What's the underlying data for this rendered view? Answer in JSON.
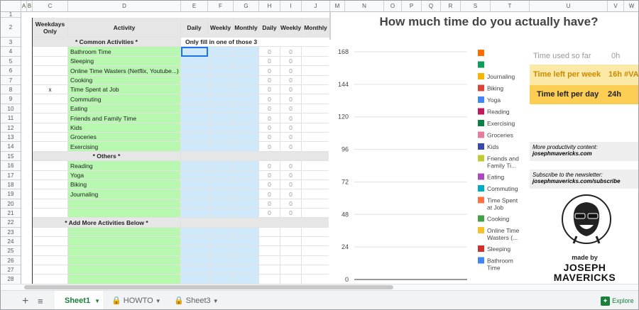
{
  "columns": [
    "A",
    "B",
    "C",
    "D",
    "E",
    "F",
    "G",
    "H",
    "I",
    "J",
    "M",
    "N",
    "O",
    "P",
    "Q",
    "R",
    "S",
    "T",
    "U",
    "V",
    "W"
  ],
  "rows": [
    "1",
    "2",
    "3",
    "4",
    "5",
    "6",
    "7",
    "8",
    "9",
    "10",
    "11",
    "12",
    "13",
    "14",
    "15",
    "16",
    "17",
    "18",
    "19",
    "20",
    "21",
    "22",
    "23",
    "24",
    "25",
    "26",
    "27",
    "28"
  ],
  "headers": {
    "weekdays_only": "Weekdays Only",
    "activity": "Activity",
    "daily": "Daily",
    "weekly": "Weekly",
    "monthly": "Monthly",
    "daily2": "Daily",
    "weekly2": "Weekly",
    "monthly2": "Monthly"
  },
  "sections": {
    "common": "* Common Activities *",
    "hint": "Only fill in one of those 3",
    "others": "* Others *",
    "add_more": "* Add More Activities Below *"
  },
  "activities_common": [
    "Bathroom Time",
    "Sleeping",
    "Online Time Wasters (Netflix, Youtube...)",
    "Cooking",
    "Time Spent at Job",
    "Commuting",
    "Eating",
    "Friends and Family Time",
    "Kids",
    "Groceries",
    "Exercising"
  ],
  "weekday_marks": [
    "",
    "",
    "",
    "",
    "x",
    "",
    "",
    "",
    "",
    "",
    ""
  ],
  "activities_other": [
    "Reading",
    "Yoga",
    "Biking",
    "Journaling",
    "",
    ""
  ],
  "zero": "0",
  "chart_data": {
    "type": "bar",
    "title": "How much time do you actually have?",
    "y_ticks": [
      "168",
      "144",
      "120",
      "96",
      "72",
      "48",
      "24",
      "0"
    ],
    "ylim": [
      0,
      168
    ],
    "series": [
      {
        "name": "",
        "color": "#ff6d01"
      },
      {
        "name": "",
        "color": "#0f9d58"
      },
      {
        "name": "Journaling",
        "color": "#f4b400"
      },
      {
        "name": "Biking",
        "color": "#db4437"
      },
      {
        "name": "Yoga",
        "color": "#4285f4"
      },
      {
        "name": "Reading",
        "color": "#c2185b"
      },
      {
        "name": "Exercising",
        "color": "#0b8043"
      },
      {
        "name": "Groceries",
        "color": "#e67c9a"
      },
      {
        "name": "Kids",
        "color": "#3949ab"
      },
      {
        "name": "Friends and Family Ti...",
        "color": "#c0ca33"
      },
      {
        "name": "Eating",
        "color": "#ab47bc"
      },
      {
        "name": "Commuting",
        "color": "#00acc1"
      },
      {
        "name": "Time Spent at Job",
        "color": "#ff7043"
      },
      {
        "name": "Cooking",
        "color": "#43a047"
      },
      {
        "name": "Online Time Wasters (...",
        "color": "#fbc02d"
      },
      {
        "name": "Sleeping",
        "color": "#d32f2f"
      },
      {
        "name": "Bathroom Time",
        "color": "#4285f4"
      }
    ]
  },
  "summary": {
    "used_label": "Time used so far",
    "used_value": "0h",
    "left_week_label": "Time left per week",
    "left_week_value": "16h #VA",
    "left_day_label": "Time left per day",
    "left_day_value": "24h"
  },
  "promo": {
    "productivity_label": "More productivity content:",
    "productivity_link": "josephmavericks.com",
    "newsletter_label": "Subscribe to the newsletter:",
    "newsletter_link": "josephmavericks.com/subscribe",
    "made_by": "made by",
    "brand_line1": "JOSEPH",
    "brand_line2": "MAVERICKS"
  },
  "tabs": {
    "sheet1": "Sheet1",
    "howto": "HOWTO",
    "sheet3": "Sheet3",
    "explore": "Explore"
  },
  "colors": {
    "green": "#b7f7b0",
    "blue": "#cfe9fb",
    "accent_green": "#188038",
    "gold": "#fbcd52",
    "pale_gold": "#fde9a7"
  }
}
